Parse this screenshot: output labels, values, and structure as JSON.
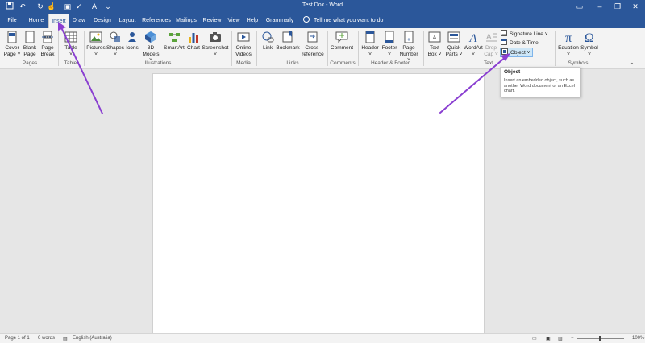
{
  "window": {
    "title": "Test Doc  -  Word"
  },
  "quick_access": [
    "save-icon",
    "undo-icon",
    "redo-icon",
    "touch-mode-icon",
    "format-painter-icon",
    "spelling-icon",
    "font-color-icon",
    "more-icon"
  ],
  "tabs": [
    "File",
    "Home",
    "Insert",
    "Draw",
    "Design",
    "Layout",
    "References",
    "Mailings",
    "Review",
    "View",
    "Help",
    "Grammarly"
  ],
  "tell_me": "Tell me what you want to do",
  "ribbon": {
    "pages": {
      "cover_1": "Cover",
      "cover_2": "Page ˅",
      "blank_1": "Blank",
      "blank_2": "Page",
      "break_1": "Page",
      "break_2": "Break",
      "group": "Pages"
    },
    "tables": {
      "table_1": "Table",
      "table_2": "˅",
      "group": "Tables"
    },
    "illustrations": {
      "pictures_1": "Pictures",
      "pictures_2": "˅",
      "shapes_1": "Shapes",
      "shapes_2": "˅",
      "icons_1": "Icons",
      "models_1": "3D",
      "models_2": "Models ˅",
      "smartart_1": "SmartArt",
      "chart_1": "Chart",
      "screenshot_1": "Screenshot",
      "screenshot_2": "˅",
      "group": "Illustrations"
    },
    "media": {
      "video_1": "Online",
      "video_2": "Videos",
      "group": "Media"
    },
    "links": {
      "link_1": "Link",
      "bookmark_1": "Bookmark",
      "xref_1": "Cross-",
      "xref_2": "reference",
      "group": "Links"
    },
    "comments": {
      "comment_1": "Comment",
      "group": "Comments"
    },
    "header_footer": {
      "header_1": "Header",
      "header_2": "˅",
      "footer_1": "Footer",
      "footer_2": "˅",
      "pagenum_1": "Page",
      "pagenum_2": "Number ˅",
      "group": "Header & Footer"
    },
    "text": {
      "textbox_1": "Text",
      "textbox_2": "Box ˅",
      "quickparts_1": "Quick",
      "quickparts_2": "Parts ˅",
      "wordart_1": "WordArt",
      "wordart_2": "˅",
      "dropcap_1": "Drop",
      "dropcap_2": "Cap ˅",
      "signature": "Signature Line  ˅",
      "datetime": "Date & Time",
      "object": "Object  ˅",
      "group": "Text"
    },
    "symbols": {
      "equation_1": "Equation",
      "equation_2": "˅",
      "symbol_1": "Symbol",
      "symbol_2": "˅",
      "group": "Symbols"
    }
  },
  "tooltip": {
    "title": "Object",
    "description": "Insert an embedded object, such as another Word document or an Excel chart."
  },
  "status": {
    "page": "Page 1 of 1",
    "words": "0 words",
    "language": "English (Australia)",
    "zoom": "100%"
  },
  "colors": {
    "brand": "#2b579a",
    "arrow": "#8a3fd1"
  }
}
